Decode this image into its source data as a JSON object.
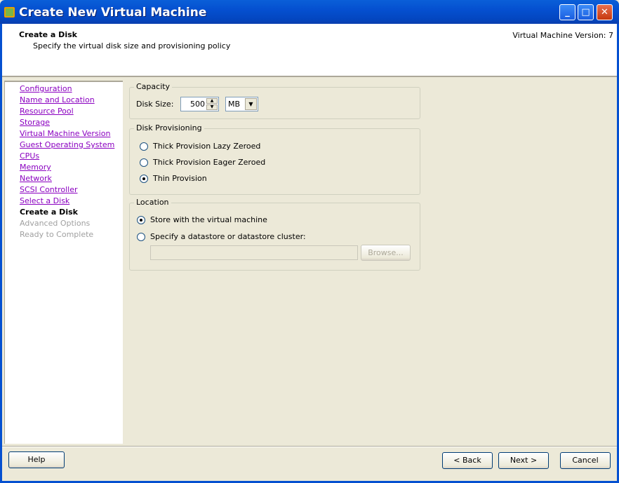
{
  "window": {
    "title": "Create New Virtual Machine",
    "minimize": "_",
    "maximize": "□",
    "close": "✕"
  },
  "header": {
    "title": "Create a Disk",
    "subtitle": "Specify the virtual disk size and provisioning policy",
    "version": "Virtual Machine Version: 7"
  },
  "nav": {
    "items": [
      {
        "label": "Configuration",
        "state": "link"
      },
      {
        "label": "Name and Location",
        "state": "link"
      },
      {
        "label": "Resource Pool",
        "state": "link"
      },
      {
        "label": "Storage",
        "state": "link"
      },
      {
        "label": "Virtual Machine Version",
        "state": "link"
      },
      {
        "label": "Guest Operating System",
        "state": "link"
      },
      {
        "label": "CPUs",
        "state": "link"
      },
      {
        "label": "Memory",
        "state": "link"
      },
      {
        "label": "Network",
        "state": "link"
      },
      {
        "label": "SCSI Controller",
        "state": "link"
      },
      {
        "label": "Select a Disk",
        "state": "link"
      },
      {
        "label": "Create a Disk",
        "state": "current"
      },
      {
        "label": "Advanced Options",
        "state": "disabled"
      },
      {
        "label": "Ready to Complete",
        "state": "disabled"
      }
    ]
  },
  "capacity": {
    "legend": "Capacity",
    "disk_size_label": "Disk Size:",
    "disk_size_value": "500",
    "unit": "MB"
  },
  "provisioning": {
    "legend": "Disk Provisioning",
    "options": [
      "Thick Provision Lazy Zeroed",
      "Thick Provision Eager Zeroed",
      "Thin Provision"
    ],
    "selected": 2
  },
  "location": {
    "legend": "Location",
    "options": [
      "Store with the virtual machine",
      "Specify a datastore or datastore cluster:"
    ],
    "selected": 0,
    "datastore_value": "",
    "browse": "Browse..."
  },
  "footer": {
    "help": "Help",
    "back": "< Back",
    "next": "Next >",
    "cancel": "Cancel"
  }
}
